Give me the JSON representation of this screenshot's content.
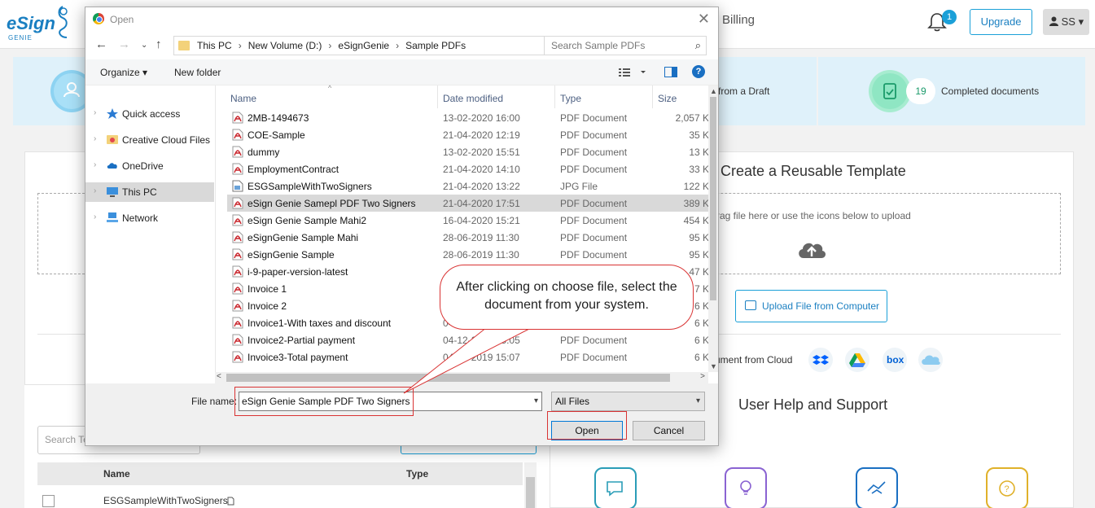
{
  "app": {
    "logo_text": "eSign",
    "logo_sub": "GENIE",
    "nav_billing": "Billing",
    "notification_count": "1",
    "upgrade_label": "Upgrade",
    "user_initials": "SS",
    "user_caret": "▾"
  },
  "stats": {
    "draft_label": "from a Draft",
    "completed_count": "19",
    "completed_label": "Completed documents"
  },
  "template": {
    "title": "Create a Reusable Template",
    "drop_text": "rag file here or use the icons below to upload",
    "upload_button": "Upload File from Computer",
    "cloud_text": "ument from Cloud",
    "cloud_providers": [
      "Dropbox",
      "Google Drive",
      "box",
      "OneDrive"
    ]
  },
  "help": {
    "title": "User Help and Support"
  },
  "templates_table": {
    "search_placeholder": "Search Te",
    "col_name": "Name",
    "col_type": "Type",
    "rows": [
      {
        "name": "ESGSampleWithTwoSigners"
      }
    ]
  },
  "dialog": {
    "title": "Open",
    "close": "✕",
    "breadcrumb": [
      "This PC",
      "New Volume (D:)",
      "eSignGenie",
      "Sample PDFs"
    ],
    "search_placeholder": "Search Sample PDFs",
    "toolbar": {
      "organize": "Organize",
      "new_folder": "New folder"
    },
    "nav": [
      {
        "label": "Quick access",
        "icon": "star-icon"
      },
      {
        "label": "Creative Cloud Files",
        "icon": "creative-cloud-icon"
      },
      {
        "label": "OneDrive",
        "icon": "onedrive-icon"
      },
      {
        "label": "This PC",
        "icon": "pc-icon",
        "selected": true
      },
      {
        "label": "Network",
        "icon": "network-icon"
      }
    ],
    "columns": {
      "name": "Name",
      "date": "Date modified",
      "type": "Type",
      "size": "Size"
    },
    "files": [
      {
        "name": "2MB-1494673",
        "date": "13-02-2020 16:00",
        "type": "PDF Document",
        "size": "2,057 K"
      },
      {
        "name": "COE-Sample",
        "date": "21-04-2020 12:19",
        "type": "PDF Document",
        "size": "35 K"
      },
      {
        "name": "dummy",
        "date": "13-02-2020 15:51",
        "type": "PDF Document",
        "size": "13 K"
      },
      {
        "name": "EmploymentContract",
        "date": "21-04-2020 14:10",
        "type": "PDF Document",
        "size": "33 K"
      },
      {
        "name": "ESGSampleWithTwoSigners",
        "date": "21-04-2020 13:22",
        "type": "JPG File",
        "size": "122 K"
      },
      {
        "name": "eSign Genie Samepl PDF Two Signers",
        "date": "21-04-2020 17:51",
        "type": "PDF Document",
        "size": "389 K",
        "selected": true
      },
      {
        "name": "eSign Genie Sample Mahi2",
        "date": "16-04-2020 15:21",
        "type": "PDF Document",
        "size": "454 K"
      },
      {
        "name": "eSignGenie Sample Mahi",
        "date": "28-06-2019 11:30",
        "type": "PDF Document",
        "size": "95 K"
      },
      {
        "name": "eSignGenie Sample",
        "date": "28-06-2019 11:30",
        "type": "PDF Document",
        "size": "95 K"
      },
      {
        "name": "i-9-paper-version-latest",
        "date": "",
        "type": "",
        "size": "47 K"
      },
      {
        "name": "Invoice 1",
        "date": "",
        "type": "",
        "size": "7 K"
      },
      {
        "name": "Invoice 2",
        "date": "",
        "type": "",
        "size": "6 K"
      },
      {
        "name": "Invoice1-With taxes and discount",
        "date": "04",
        "type": "",
        "size": "6 K"
      },
      {
        "name": "Invoice2-Partial payment",
        "date": "04-12-2019 15:05",
        "type": "PDF Document",
        "size": "6 K"
      },
      {
        "name": "Invoice3-Total payment",
        "date": "04-12-2019 15:07",
        "type": "PDF Document",
        "size": "6 K"
      }
    ],
    "file_name_label": "File name:",
    "file_name_value": "eSign Genie Sample PDF Two Signers",
    "file_type_value": "All Files",
    "open_button": "Open",
    "cancel_button": "Cancel"
  },
  "annotation": {
    "callout_text": "After clicking on choose file, select the document from your system."
  },
  "colors": {
    "brand": "#1a7fc1",
    "accent": "#1ba0d8",
    "annotation_red": "#d93333",
    "selected_row": "#d9d9d9"
  }
}
